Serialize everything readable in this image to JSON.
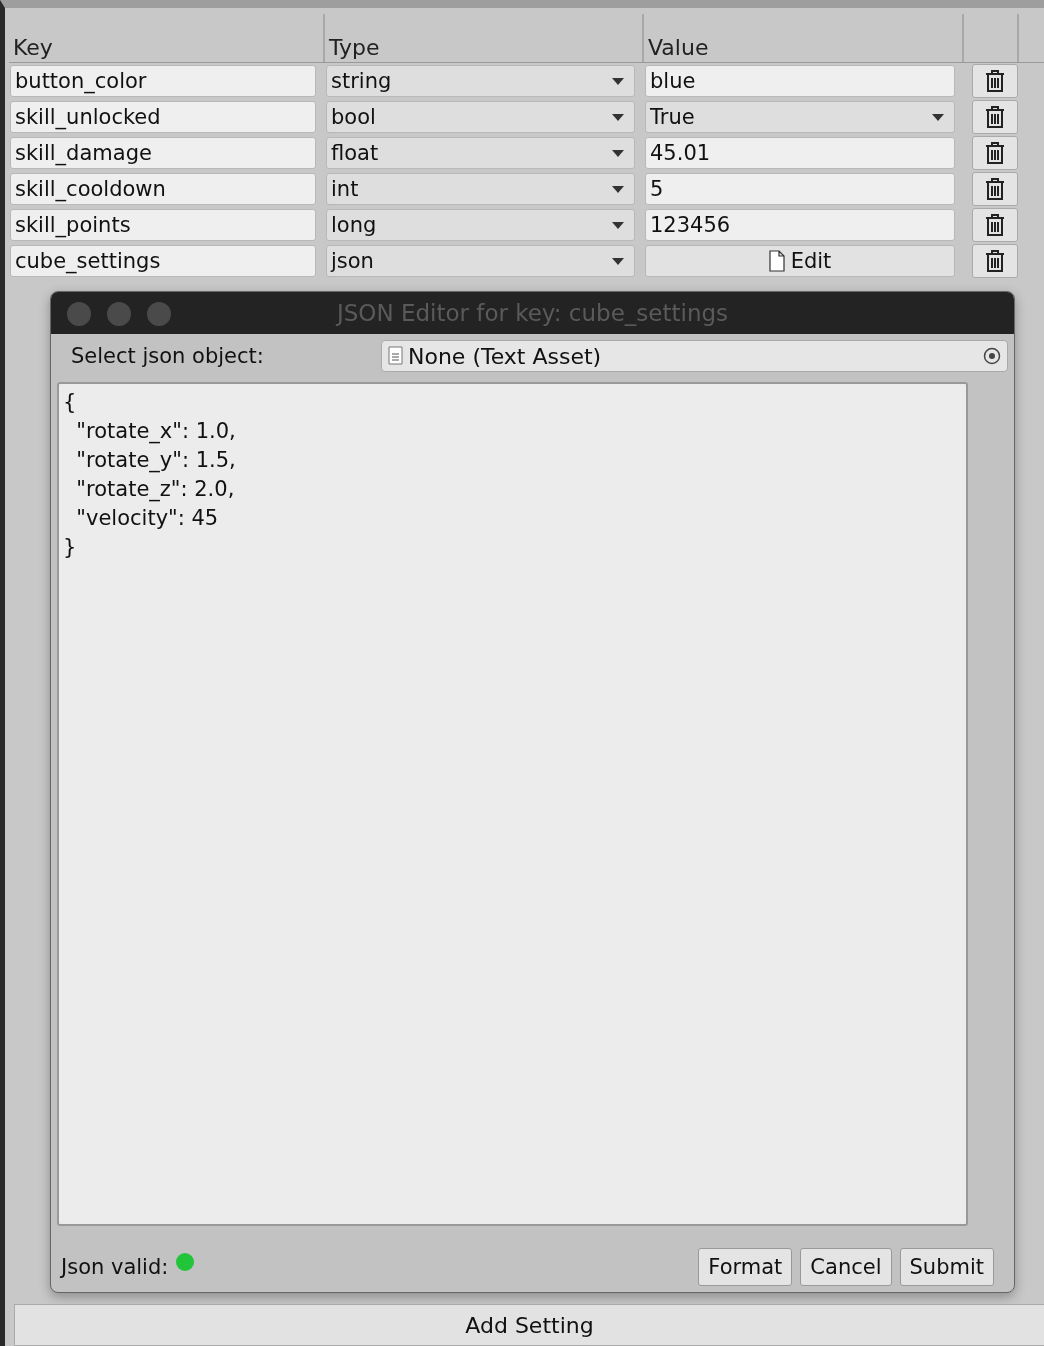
{
  "table": {
    "columns": [
      "Key",
      "Type",
      "Value"
    ],
    "rows": [
      {
        "key": "button_color",
        "type": "string",
        "kind": "text",
        "value": "blue"
      },
      {
        "key": "skill_unlocked",
        "type": "bool",
        "kind": "dropdown",
        "value": "True"
      },
      {
        "key": "skill_damage",
        "type": "float",
        "kind": "text",
        "value": "45.01"
      },
      {
        "key": "skill_cooldown",
        "type": "int",
        "kind": "text",
        "value": "5"
      },
      {
        "key": "skill_points",
        "type": "long",
        "kind": "text",
        "value": "123456"
      },
      {
        "key": "cube_settings",
        "type": "json",
        "kind": "button",
        "value": "Edit"
      }
    ]
  },
  "dialog": {
    "title": "JSON Editor for key: cube_settings",
    "select_label": "Select json object:",
    "object_field": "None (Text Asset)",
    "json_text": "{\n  \"rotate_x\": 1.0,\n  \"rotate_y\": 1.5,\n  \"rotate_z\": 2.0,\n  \"velocity\": 45\n}",
    "valid_label": "Json valid:",
    "valid": true,
    "buttons": [
      "Format",
      "Cancel",
      "Submit"
    ]
  },
  "add_button": "Add Setting"
}
